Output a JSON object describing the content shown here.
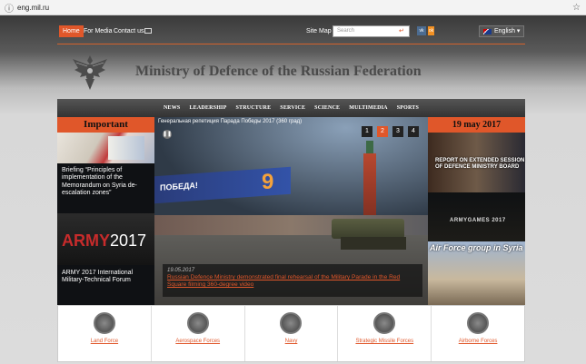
{
  "browser": {
    "url": "eng.mil.ru"
  },
  "topnav": {
    "home": "Home",
    "media": "For Media",
    "contact": "Contact us",
    "sitemap": "Site Map",
    "search_placeholder": "Search",
    "language": "English"
  },
  "header": {
    "title": "Ministry of Defence of the Russian Federation"
  },
  "menu": [
    "NEWS",
    "LEADERSHIP",
    "STRUCTURE",
    "SERVICE",
    "SCIENCE",
    "MULTIMEDIA",
    "SPORTS"
  ],
  "left": {
    "title": "Important",
    "briefing": "Briefing “Principles of implementation of the Memorandum on Syria de-escalation zones”",
    "army_logo_a": "ARMY",
    "army_logo_b": "2017",
    "army_caption": "ARMY 2017 International Military-Technical Forum"
  },
  "slider": {
    "headline": "Генеральная репетиция Парада Победы 2017 (360 град)",
    "banner": "ПОБЕДА!",
    "nine": "9",
    "pages": [
      "1",
      "2",
      "3",
      "4"
    ],
    "active_page": "2",
    "date": "19.05.2017",
    "caption": "Russian Defence Ministry demonstrated final rehearsal of the Military Parade in the Red Square filming 360-degree video"
  },
  "right": {
    "title": "19 may 2017",
    "report": "REPORT ON EXTENDED SESSION OF DEFENCE MINISTRY BOARD",
    "armygames": "ARMYGAMES 2017",
    "airforce": "Air Force group in Syria"
  },
  "forces": [
    "Land Force",
    "Aerospace Forces",
    "Navy",
    "Strategic Missile Forces",
    "Airborne Forces"
  ],
  "colors": {
    "accent": "#e0572a",
    "dark": "#222222"
  }
}
